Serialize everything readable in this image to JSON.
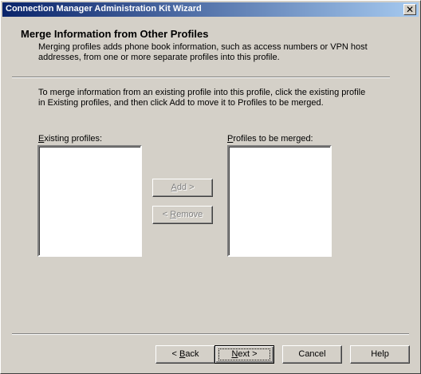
{
  "window": {
    "title": "Connection Manager Administration Kit Wizard",
    "close_glyph": "✕"
  },
  "header": {
    "title": "Merge Information from Other Profiles",
    "description": "Merging profiles adds phone book information, such as access numbers or VPN host addresses, from one or more separate profiles into this profile."
  },
  "body": {
    "instructions": "To merge information from an existing profile into this profile, click the existing profile in Existing profiles, and then click Add to move it to Profiles to be merged.",
    "existing_label_first": "E",
    "existing_label_rest": "xisting profiles:",
    "merged_label_first": "P",
    "merged_label_rest": "rofiles to be merged:",
    "existing_items": [],
    "merged_items": [],
    "add_first": "A",
    "add_rest": "dd >",
    "remove_prefix": "< ",
    "remove_first": "R",
    "remove_rest": "emove"
  },
  "footer": {
    "back_prefix": "< ",
    "back_first": "B",
    "back_rest": "ack",
    "next_first": "N",
    "next_rest": "ext >",
    "cancel": "Cancel",
    "help": "Help"
  }
}
